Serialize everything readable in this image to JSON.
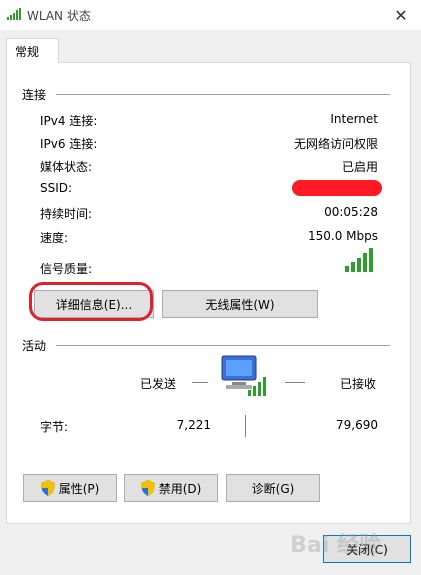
{
  "window": {
    "title": "WLAN 状态",
    "close_glyph": "✕"
  },
  "tab": {
    "label": "常规"
  },
  "connection": {
    "heading": "连接",
    "rows": [
      {
        "label": "IPv4 连接:",
        "value": "Internet"
      },
      {
        "label": "IPv6 连接:",
        "value": "无网络访问权限"
      },
      {
        "label": "媒体状态:",
        "value": "已启用"
      },
      {
        "label": "SSID:",
        "value": ""
      },
      {
        "label": "持续时间:",
        "value": "00:05:28"
      },
      {
        "label": "速度:",
        "value": "150.0 Mbps"
      }
    ],
    "signal_label": "信号质量:",
    "signal_bars": 5
  },
  "buttons": {
    "details": "详细信息(E)...",
    "wireless_properties": "无线属性(W)",
    "properties": "属性(P)",
    "disable": "禁用(D)",
    "diagnose": "诊断(G)",
    "close": "关闭(C)"
  },
  "activity": {
    "heading": "活动",
    "sent_label": "已发送",
    "received_label": "已接收",
    "bytes_label": "字节:",
    "bytes_sent": "7,221",
    "bytes_received": "79,690"
  },
  "colors": {
    "highlight": "#e0202a",
    "signal_green": "#2e9e2e",
    "button_bg": "#e1e1e1"
  },
  "watermark": "Bai 经验"
}
